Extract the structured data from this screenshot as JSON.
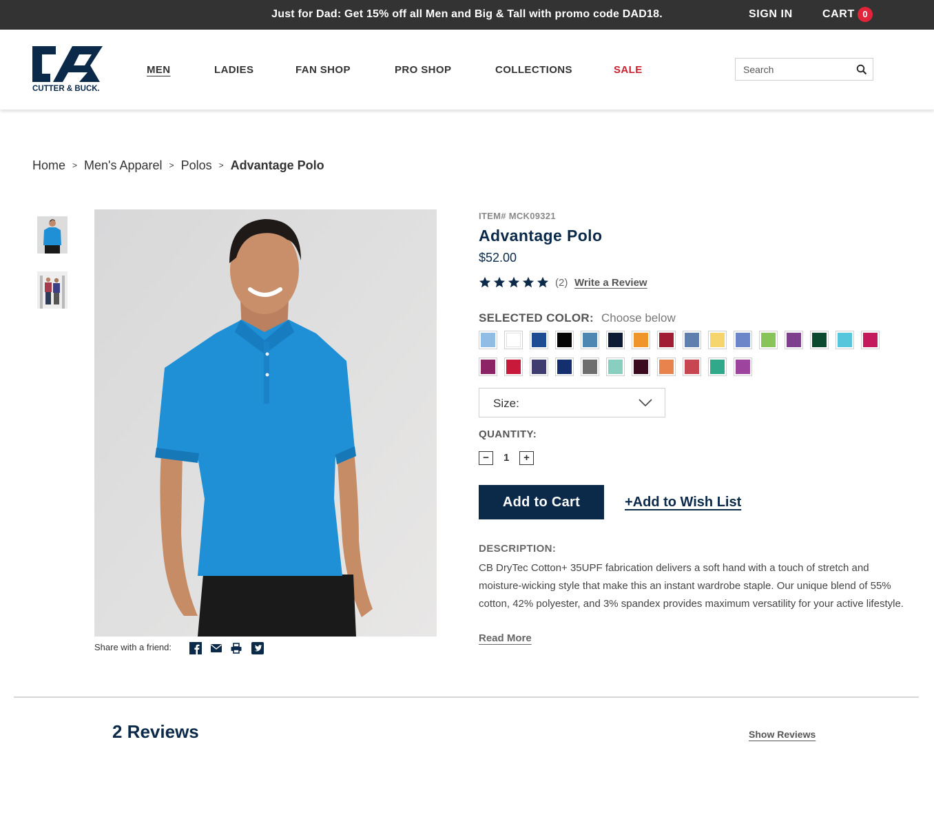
{
  "promo": {
    "message": "Just for Dad: Get 15% off all Men and Big & Tall with promo code DAD18.",
    "sign_in": "SIGN IN",
    "cart_label": "CART",
    "cart_count": "0"
  },
  "brand": {
    "logo_text": "CUTTER & BUCK."
  },
  "nav": {
    "items": [
      "MEN",
      "LADIES",
      "FAN SHOP",
      "PRO SHOP",
      "COLLECTIONS",
      "SALE"
    ]
  },
  "search": {
    "placeholder": "Search"
  },
  "breadcrumb": [
    "Home",
    "Men's Apparel",
    "Polos",
    "Advantage Polo"
  ],
  "share": {
    "label": "Share with a friend:"
  },
  "product": {
    "item_number": "ITEM# MCK09321",
    "title": "Advantage Polo",
    "price": "$52.00",
    "rating": 5,
    "rating_count": "(2)",
    "write_review": "Write a Review",
    "selected_color_label": "SELECTED COLOR:",
    "selected_color_value": "Choose below",
    "colors_row1": [
      "#8fbde6",
      "#ffffff",
      "#1d4c94",
      "#050505",
      "#4f87b3",
      "#0d1b34",
      "#f0952a",
      "#a01d35",
      "#5f7fae",
      "#f5d56c",
      "#6d86c9",
      "#88c45a",
      "#7e3f8c",
      "#0c4a30",
      "#55c6dc",
      "#c4195a"
    ],
    "colors_row2": [
      "#8c2366",
      "#c9193a",
      "#3f3c6f",
      "#142f6d",
      "#6e6e6e",
      "#88cfc0",
      "#3b0a1f",
      "#e8834e",
      "#c8464f",
      "#2fa98a",
      "#9d449f"
    ],
    "size_label": "Size:",
    "quantity_label": "QUANTITY:",
    "quantity_value": "1",
    "qty_minus": "−",
    "qty_plus": "+",
    "add_to_cart": "Add to Cart",
    "add_to_wish_list": "+Add to Wish List",
    "description_label": "DESCRIPTION:",
    "description": "CB DryTec Cotton+ 35UPF fabrication delivers a soft hand with a touch of stretch and moisture-wicking style that make this an instant wardrobe staple. Our unique blend of 55% cotton, 42% polyester, and 3% spandex provides maximum versatility for your active lifestyle.",
    "read_more": "Read More"
  },
  "reviews": {
    "title": "2 Reviews",
    "show_reviews": "Show Reviews"
  },
  "colors": {
    "navy": "#0b2a4a",
    "sale_red": "#c8202f",
    "promo_bg": "#333333",
    "polo_blue": "#1f8fd6"
  }
}
